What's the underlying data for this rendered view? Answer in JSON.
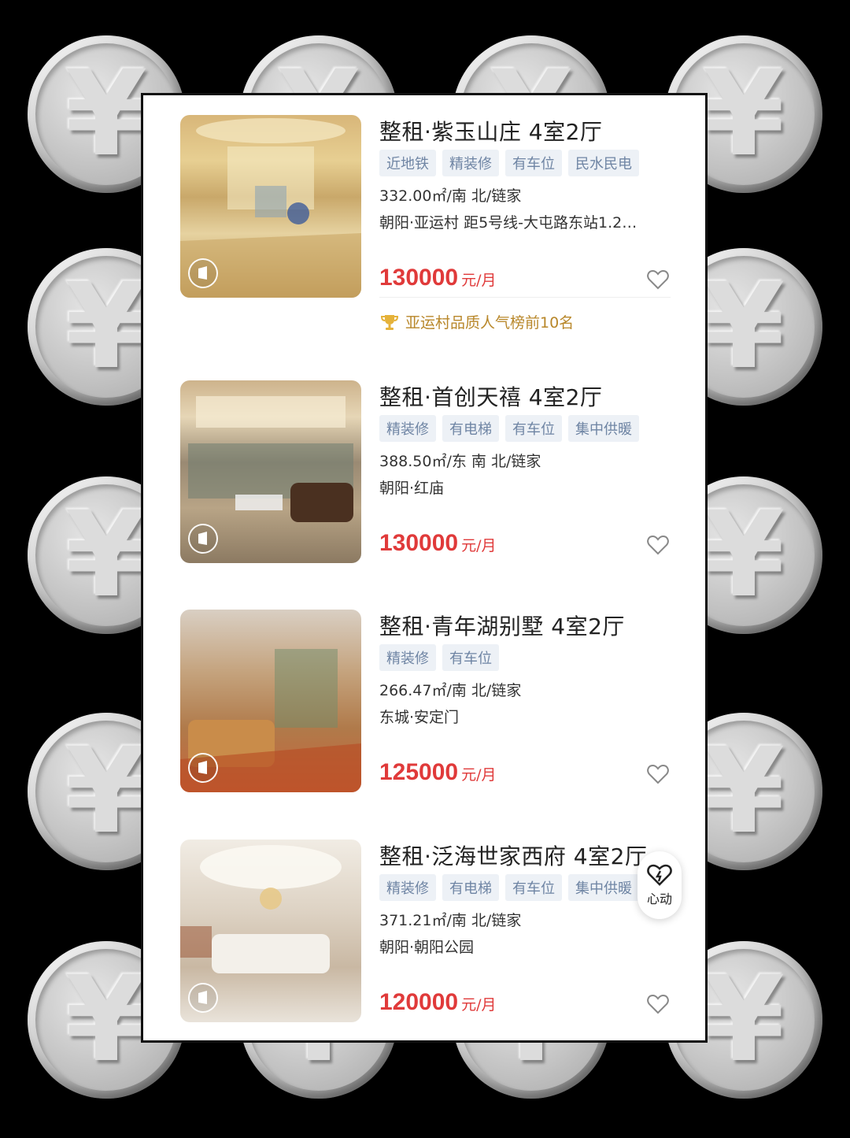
{
  "listings": [
    {
      "title": "整租·紫玉山庄 4室2厅",
      "tags": [
        "近地铁",
        "精装修",
        "有车位",
        "民水民电"
      ],
      "area": "332.00㎡/南 北/链家",
      "location": "朝阳·亚运村 距5号线-大屯路东站1.2…",
      "price": "130000",
      "unit": "元/月",
      "rank": "亚运村品质人气榜前10名"
    },
    {
      "title": "整租·首创天禧 4室2厅",
      "tags": [
        "精装修",
        "有电梯",
        "有车位",
        "集中供暖"
      ],
      "area": "388.50㎡/东 南 北/链家",
      "location": "朝阳·红庙",
      "price": "130000",
      "unit": "元/月"
    },
    {
      "title": "整租·青年湖别墅 4室2厅",
      "tags": [
        "精装修",
        "有车位"
      ],
      "area": "266.47㎡/南 北/链家",
      "location": "东城·安定门",
      "price": "125000",
      "unit": "元/月"
    },
    {
      "title": "整租·泛海世家西府 4室2厅",
      "tags": [
        "精装修",
        "有电梯",
        "有车位",
        "集中供暖"
      ],
      "area": "371.21㎡/南 北/链家",
      "location": "朝阳·朝阳公园",
      "price": "120000",
      "unit": "元/月"
    }
  ],
  "float_button": {
    "label": "心动",
    "icon": "heart-lightning-icon"
  },
  "background": {
    "icon": "yen-coin-icon",
    "symbol": "¥"
  },
  "colors": {
    "price": "#e03a3a",
    "tag_text": "#6f85a4",
    "tag_bg": "#edf1f6",
    "rank": "#b8872a"
  }
}
